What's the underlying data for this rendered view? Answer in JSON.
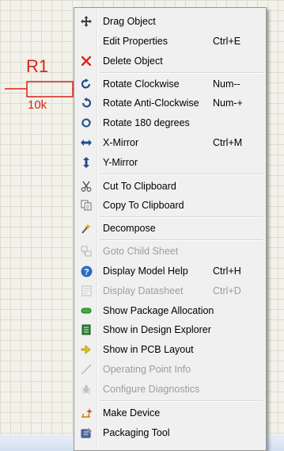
{
  "schematic": {
    "ref": "R1",
    "value": "10k",
    "wire_color": "#d8231b"
  },
  "menu": {
    "items": [
      {
        "label": "Drag Object",
        "shortcut": "",
        "icon": "move-cross-icon",
        "enabled": true
      },
      {
        "label": "Edit Properties",
        "shortcut": "Ctrl+E",
        "icon": "",
        "enabled": true
      },
      {
        "label": "Delete Object",
        "shortcut": "",
        "icon": "red-x-icon",
        "enabled": true
      },
      {
        "label": "Rotate Clockwise",
        "shortcut": "Num--",
        "icon": "rotate-clockwise-icon",
        "enabled": true
      },
      {
        "label": "Rotate Anti-Clockwise",
        "shortcut": "Num-+",
        "icon": "rotate-anticlockwise-icon",
        "enabled": true
      },
      {
        "label": "Rotate 180 degrees",
        "shortcut": "",
        "icon": "rotate-180-icon",
        "enabled": true
      },
      {
        "label": "X-Mirror",
        "shortcut": "Ctrl+M",
        "icon": "x-mirror-icon",
        "enabled": true
      },
      {
        "label": "Y-Mirror",
        "shortcut": "",
        "icon": "y-mirror-icon",
        "enabled": true
      },
      {
        "label": "Cut To Clipboard",
        "shortcut": "",
        "icon": "scissors-icon",
        "enabled": true
      },
      {
        "label": "Copy To Clipboard",
        "shortcut": "",
        "icon": "copy-icon",
        "enabled": true
      },
      {
        "label": "Decompose",
        "shortcut": "",
        "icon": "decompose-wand-icon",
        "enabled": true
      },
      {
        "label": "Goto Child Sheet",
        "shortcut": "",
        "icon": "child-sheet-icon",
        "enabled": false
      },
      {
        "label": "Display Model Help",
        "shortcut": "Ctrl+H",
        "icon": "help-icon",
        "enabled": true
      },
      {
        "label": "Display Datasheet",
        "shortcut": "Ctrl+D",
        "icon": "datasheet-icon",
        "enabled": false
      },
      {
        "label": "Show Package Allocation",
        "shortcut": "",
        "icon": "package-allocation-icon",
        "enabled": true
      },
      {
        "label": "Show in Design Explorer",
        "shortcut": "",
        "icon": "design-explorer-icon",
        "enabled": true
      },
      {
        "label": "Show in PCB Layout",
        "shortcut": "",
        "icon": "pcb-layout-icon",
        "enabled": true
      },
      {
        "label": "Operating Point Info",
        "shortcut": "",
        "icon": "operating-point-icon",
        "enabled": false
      },
      {
        "label": "Configure Diagnostics",
        "shortcut": "",
        "icon": "diagnostics-bug-icon",
        "enabled": false
      },
      {
        "label": "Make Device",
        "shortcut": "",
        "icon": "make-device-icon",
        "enabled": true
      },
      {
        "label": "Packaging Tool",
        "shortcut": "",
        "icon": "packaging-tool-icon",
        "enabled": true
      }
    ]
  }
}
